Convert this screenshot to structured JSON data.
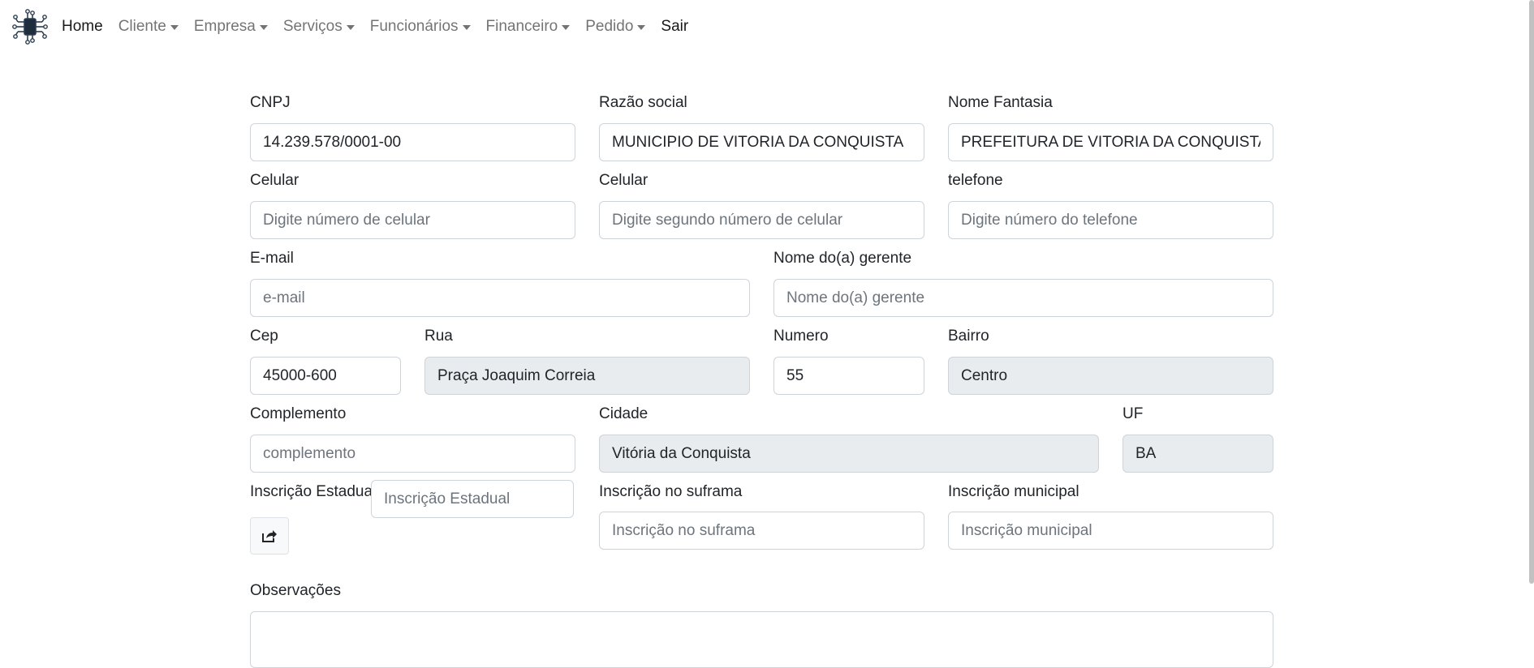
{
  "nav": {
    "home": "Home",
    "cliente": "Cliente",
    "empresa": "Empresa",
    "servicos": "Serviços",
    "funcionarios": "Funcionários",
    "financeiro": "Financeiro",
    "pedido": "Pedido",
    "sair": "Sair"
  },
  "form": {
    "cnpj": {
      "label": "CNPJ",
      "value": "14.239.578/0001-00"
    },
    "razao_social": {
      "label": "Razão social",
      "value": "MUNICIPIO DE VITORIA DA CONQUISTA"
    },
    "nome_fantasia": {
      "label": "Nome Fantasia",
      "value": "PREFEITURA DE VITORIA DA CONQUISTA"
    },
    "celular1": {
      "label": "Celular",
      "placeholder": "Digite número de celular"
    },
    "celular2": {
      "label": "Celular",
      "placeholder": "Digite segundo número de celular"
    },
    "telefone": {
      "label": "telefone",
      "placeholder": "Digite número do telefone"
    },
    "email": {
      "label": "E-mail",
      "placeholder": "e-mail"
    },
    "gerente": {
      "label": "Nome do(a) gerente",
      "placeholder": "Nome do(a) gerente"
    },
    "cep": {
      "label": "Cep",
      "value": "45000-600"
    },
    "rua": {
      "label": "Rua",
      "value": "Praça Joaquim Correia"
    },
    "numero": {
      "label": "Numero",
      "value": "55"
    },
    "bairro": {
      "label": "Bairro",
      "value": "Centro"
    },
    "complemento": {
      "label": "Complemento",
      "placeholder": "complemento"
    },
    "cidade": {
      "label": "Cidade",
      "value": "Vitória da Conquista"
    },
    "uf": {
      "label": "UF",
      "value": "BA"
    },
    "inscricao_estadual": {
      "label": "Inscrição Estadual",
      "placeholder": "Inscrição Estadual"
    },
    "suframa": {
      "label": "Inscrição no suframa",
      "placeholder": "Inscrição no suframa"
    },
    "municipal": {
      "label": "Inscrição municipal",
      "placeholder": "Inscrição municipal"
    },
    "observacoes": {
      "label": "Observações"
    }
  },
  "icons": {
    "logo": "chip-circuit-icon",
    "share": "share-square-icon"
  }
}
